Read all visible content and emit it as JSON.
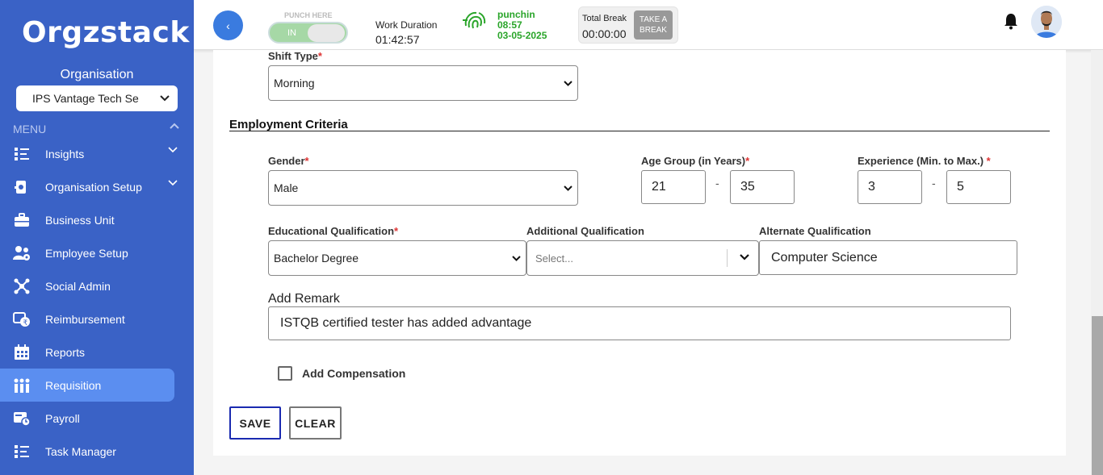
{
  "sidebar": {
    "logo": "Orgzstack",
    "org_label": "Organisation",
    "org_selected": "IPS Vantage Tech Se",
    "menu_label": "MENU",
    "items": [
      {
        "label": "Insights",
        "icon": "insights-icon"
      },
      {
        "label": "Organisation Setup",
        "icon": "org-setup-icon"
      },
      {
        "label": "Business Unit",
        "icon": "briefcase-icon"
      },
      {
        "label": "Employee Setup",
        "icon": "employees-icon"
      },
      {
        "label": "Social Admin",
        "icon": "social-icon"
      },
      {
        "label": "Reimbursement",
        "icon": "reimbursement-icon"
      },
      {
        "label": "Reports",
        "icon": "reports-icon"
      },
      {
        "label": "Requisition",
        "icon": "requisition-icon"
      },
      {
        "label": "Payroll",
        "icon": "payroll-icon"
      },
      {
        "label": "Task Manager",
        "icon": "task-icon"
      }
    ]
  },
  "topbar": {
    "back_glyph": "‹",
    "punch_label": "PUNCH HERE",
    "toggle_label": "IN",
    "work_duration_label": "Work Duration",
    "work_duration_value": "01:42:57",
    "punch_status": "punchin",
    "punch_time": "08:57",
    "punch_date": "03-05-2025",
    "total_break_label": "Total Break",
    "total_break_value": "00:00:00",
    "take_break_line1": "TAKE A",
    "take_break_line2": "BREAK"
  },
  "form": {
    "shift_type_label": "Shift Type",
    "shift_type_value": "Morning",
    "section_title": "Employment Criteria",
    "gender_label": "Gender",
    "gender_value": "Male",
    "age_label": "Age Group (in Years)",
    "age_min": "21",
    "age_max": "35",
    "experience_label": "Experience (Min. to Max.) ",
    "exp_min": "3",
    "exp_max": "5",
    "edu_label": "Educational Qualification",
    "edu_value": "Bachelor Degree",
    "add_qual_label": "Additional Qualification",
    "add_qual_placeholder": "Select...",
    "alt_qual_label": "Alternate Qualification",
    "alt_qual_value": "Computer Science",
    "remark_label": "Add Remark",
    "remark_value": "ISTQB certified tester has added advantage",
    "compensation_label": "Add Compensation",
    "required_mark": "*",
    "range_dash": "-",
    "save_label": "SAVE",
    "clear_label": "CLEAR"
  },
  "colors": {
    "sidebar": "#3a62c6",
    "active_item": "#5b8ef0",
    "punch_green": "#2aa52a",
    "required": "#d33333",
    "save_border": "#1a2ab0"
  }
}
